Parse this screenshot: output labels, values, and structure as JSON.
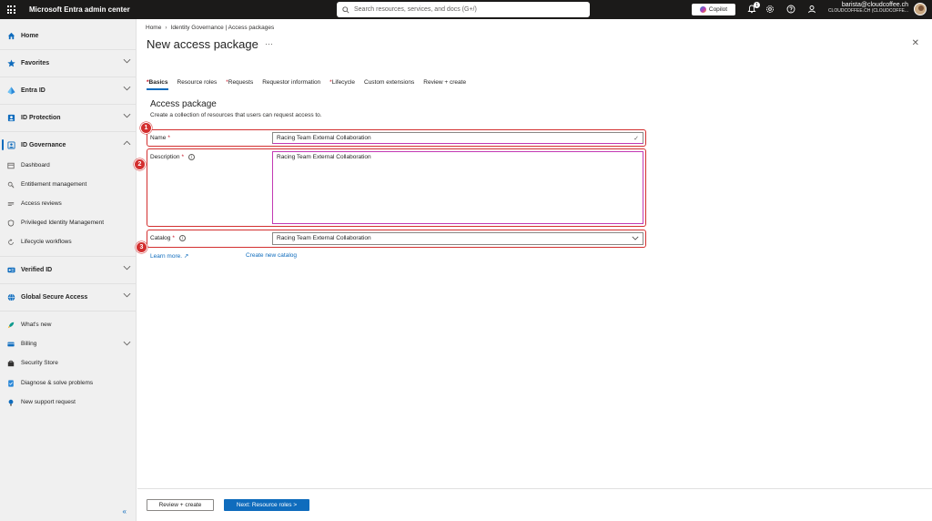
{
  "topbar": {
    "app_title": "Microsoft Entra admin center",
    "search_placeholder": "Search resources, services, and docs (G+/)",
    "copilot_label": "Copilot",
    "notification_count": "1",
    "user_name": "barista@cloudcoffee.ch",
    "user_tenant": "CLOUDCOFFEE.CH (CLOUDCOFFE..."
  },
  "sidebar": {
    "home": "Home",
    "favorites": "Favorites",
    "entra_id": "Entra ID",
    "id_protection": "ID Protection",
    "id_governance": "ID Governance",
    "gov_items": {
      "dashboard": "Dashboard",
      "entitlement": "Entitlement management",
      "access_reviews": "Access reviews",
      "pim": "Privileged Identity Management",
      "lifecycle": "Lifecycle workflows"
    },
    "verified_id": "Verified ID",
    "global_secure_access": "Global Secure Access",
    "whats_new": "What's new",
    "billing": "Billing",
    "security_store": "Security Store",
    "diagnose": "Diagnose & solve problems",
    "support": "New support request",
    "collapse_glyph": "«"
  },
  "main": {
    "breadcrumb": [
      "Home",
      "Identity Governance | Access packages"
    ],
    "title": "New access package",
    "ellipsis": "···",
    "close": "✕",
    "tabs": {
      "basics": "Basics",
      "resource_roles": "Resource roles",
      "requests": "Requests",
      "requestor_info": "Requestor information",
      "lifecycle": "Lifecycle",
      "custom_extensions": "Custom extensions",
      "review_create": "Review + create"
    },
    "section_title": "Access package",
    "section_desc": "Create a collection of resources that users can request access to.",
    "form": {
      "name_label": "Name",
      "name_value": "Racing Team External Collaboration",
      "description_label": "Description",
      "description_value": "Racing Team External Collaboration",
      "catalog_label": "Catalog",
      "catalog_value": "Racing Team External Collaboration",
      "required_mark": "*",
      "info_glyph": "i"
    },
    "steps": [
      "1",
      "2",
      "3"
    ],
    "learn_more": "Learn more.",
    "create_catalog": "Create new catalog",
    "footer": {
      "review_create": "Review + create",
      "next": "Next: Resource roles >"
    }
  },
  "colors": {
    "accent": "#0f6cbd",
    "annotation": "#d32f2f",
    "topbar": "#1b1a19",
    "sidebar": "#f0f0f0"
  }
}
